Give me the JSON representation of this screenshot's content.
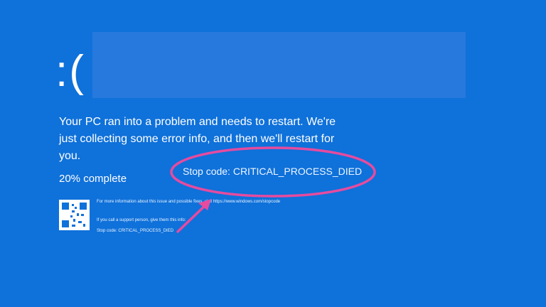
{
  "screen": {
    "face": ":(",
    "headline": "Your PC ran into a problem and needs to restart. We're just collecting some error info, and then we'll restart for you.",
    "progress": "20% complete",
    "stop_code_label": "Stop code: CRITICAL_PROCESS_DIED",
    "info_line_1": "For more information about this issue and possible fixes, visit https://www.windows.com/stopcode",
    "info_line_2": "If you call a support person, give them this info:",
    "info_line_3": "Stop code: CRITICAL_PROCESS_DIED"
  },
  "colors": {
    "background": "#0f71da",
    "annotation": "#e64b9f"
  },
  "icons": {
    "qr": "qr-code-icon"
  }
}
